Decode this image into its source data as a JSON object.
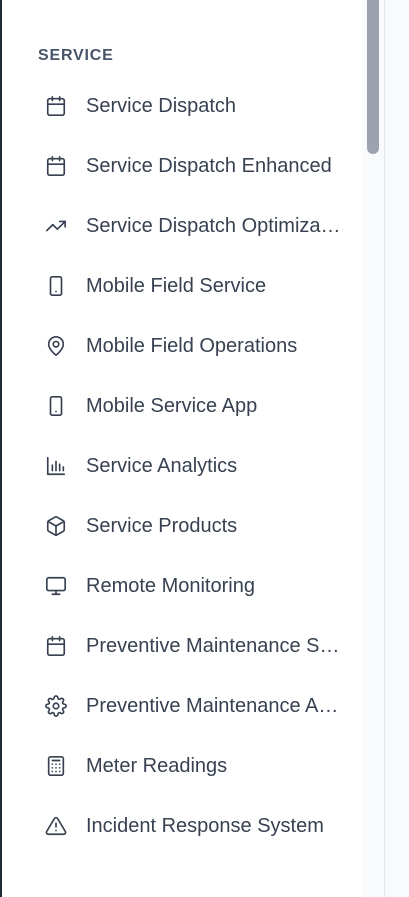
{
  "sidebar": {
    "section_title": "SERVICE",
    "items": [
      {
        "label": "Service Dispatch",
        "icon": "calendar-icon"
      },
      {
        "label": "Service Dispatch Enhanced",
        "icon": "calendar-icon"
      },
      {
        "label": "Service Dispatch Optimization",
        "icon": "trending-up-icon"
      },
      {
        "label": "Mobile Field Service",
        "icon": "smartphone-icon"
      },
      {
        "label": "Mobile Field Operations",
        "icon": "map-pin-icon"
      },
      {
        "label": "Mobile Service App",
        "icon": "smartphone-icon"
      },
      {
        "label": "Service Analytics",
        "icon": "bar-chart-icon"
      },
      {
        "label": "Service Products",
        "icon": "package-icon"
      },
      {
        "label": "Remote Monitoring",
        "icon": "monitor-icon"
      },
      {
        "label": "Preventive Maintenance Scheduling",
        "icon": "calendar-icon"
      },
      {
        "label": "Preventive Maintenance Automation",
        "icon": "gear-icon"
      },
      {
        "label": "Meter Readings",
        "icon": "calculator-icon"
      },
      {
        "label": "Incident Response System",
        "icon": "alert-triangle-icon"
      }
    ]
  },
  "colors": {
    "text": "#374151",
    "section_title": "#475569",
    "scrollbar_thumb": "#9ca3af",
    "pane_background": "#f8fafc"
  }
}
